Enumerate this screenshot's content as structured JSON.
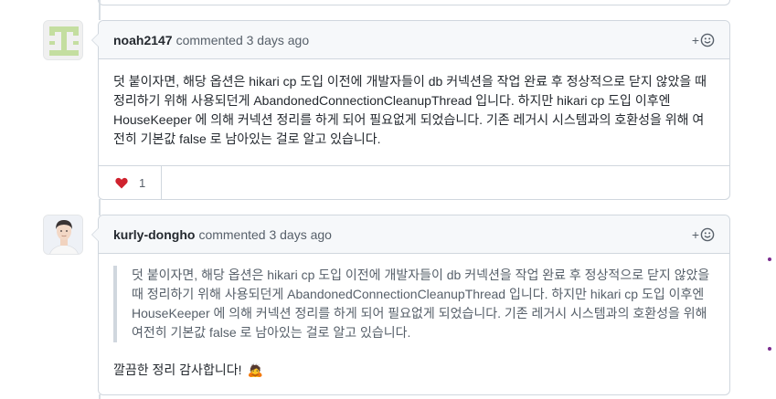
{
  "comments": [
    {
      "author": "noah2147",
      "meta": "commented 3 days ago",
      "body": "덧 붙이자면, 해당 옵션은 hikari cp 도입 이전에 개발자들이 db 커넥션을 작업 완료 후 정상적으로 닫지 않았을 때 정리하기 위해 사용되던게 AbandonedConnectionCleanupThread 입니다. 하지만 hikari cp 도입 이후엔 HouseKeeper 에 의해 커넥션 정리를 하게 되어 필요없게 되었습니다. 기존 레거시 시스템과의 호환성을 위해 여전히 기본값 false 로 남아있는 걸로 알고 있습니다.",
      "reaction": {
        "icon": "heart-icon",
        "count": "1",
        "color": "#cf222e"
      }
    },
    {
      "author": "kurly-dongho",
      "meta": "commented 3 days ago",
      "quote": "덧 붙이자면, 해당 옵션은 hikari cp 도입 이전에 개발자들이 db 커넥션을 작업 완료 후 정상적으로 닫지 않았을 때 정리하기 위해 사용되던게 AbandonedConnectionCleanupThread 입니다. 하지만 hikari cp 도입 이후엔 HouseKeeper 에 의해 커넥션 정리를 하게 되어 필요없게 되었습니다. 기존 레거시 시스템과의 호환성을 위해 여전히 기본값 false 로 남아있는 걸로 알고 있습니다.",
      "reply": "깔끔한 정리 감사합니다!",
      "reply_emoji": "🙇"
    }
  ],
  "add_reaction_label": "+"
}
